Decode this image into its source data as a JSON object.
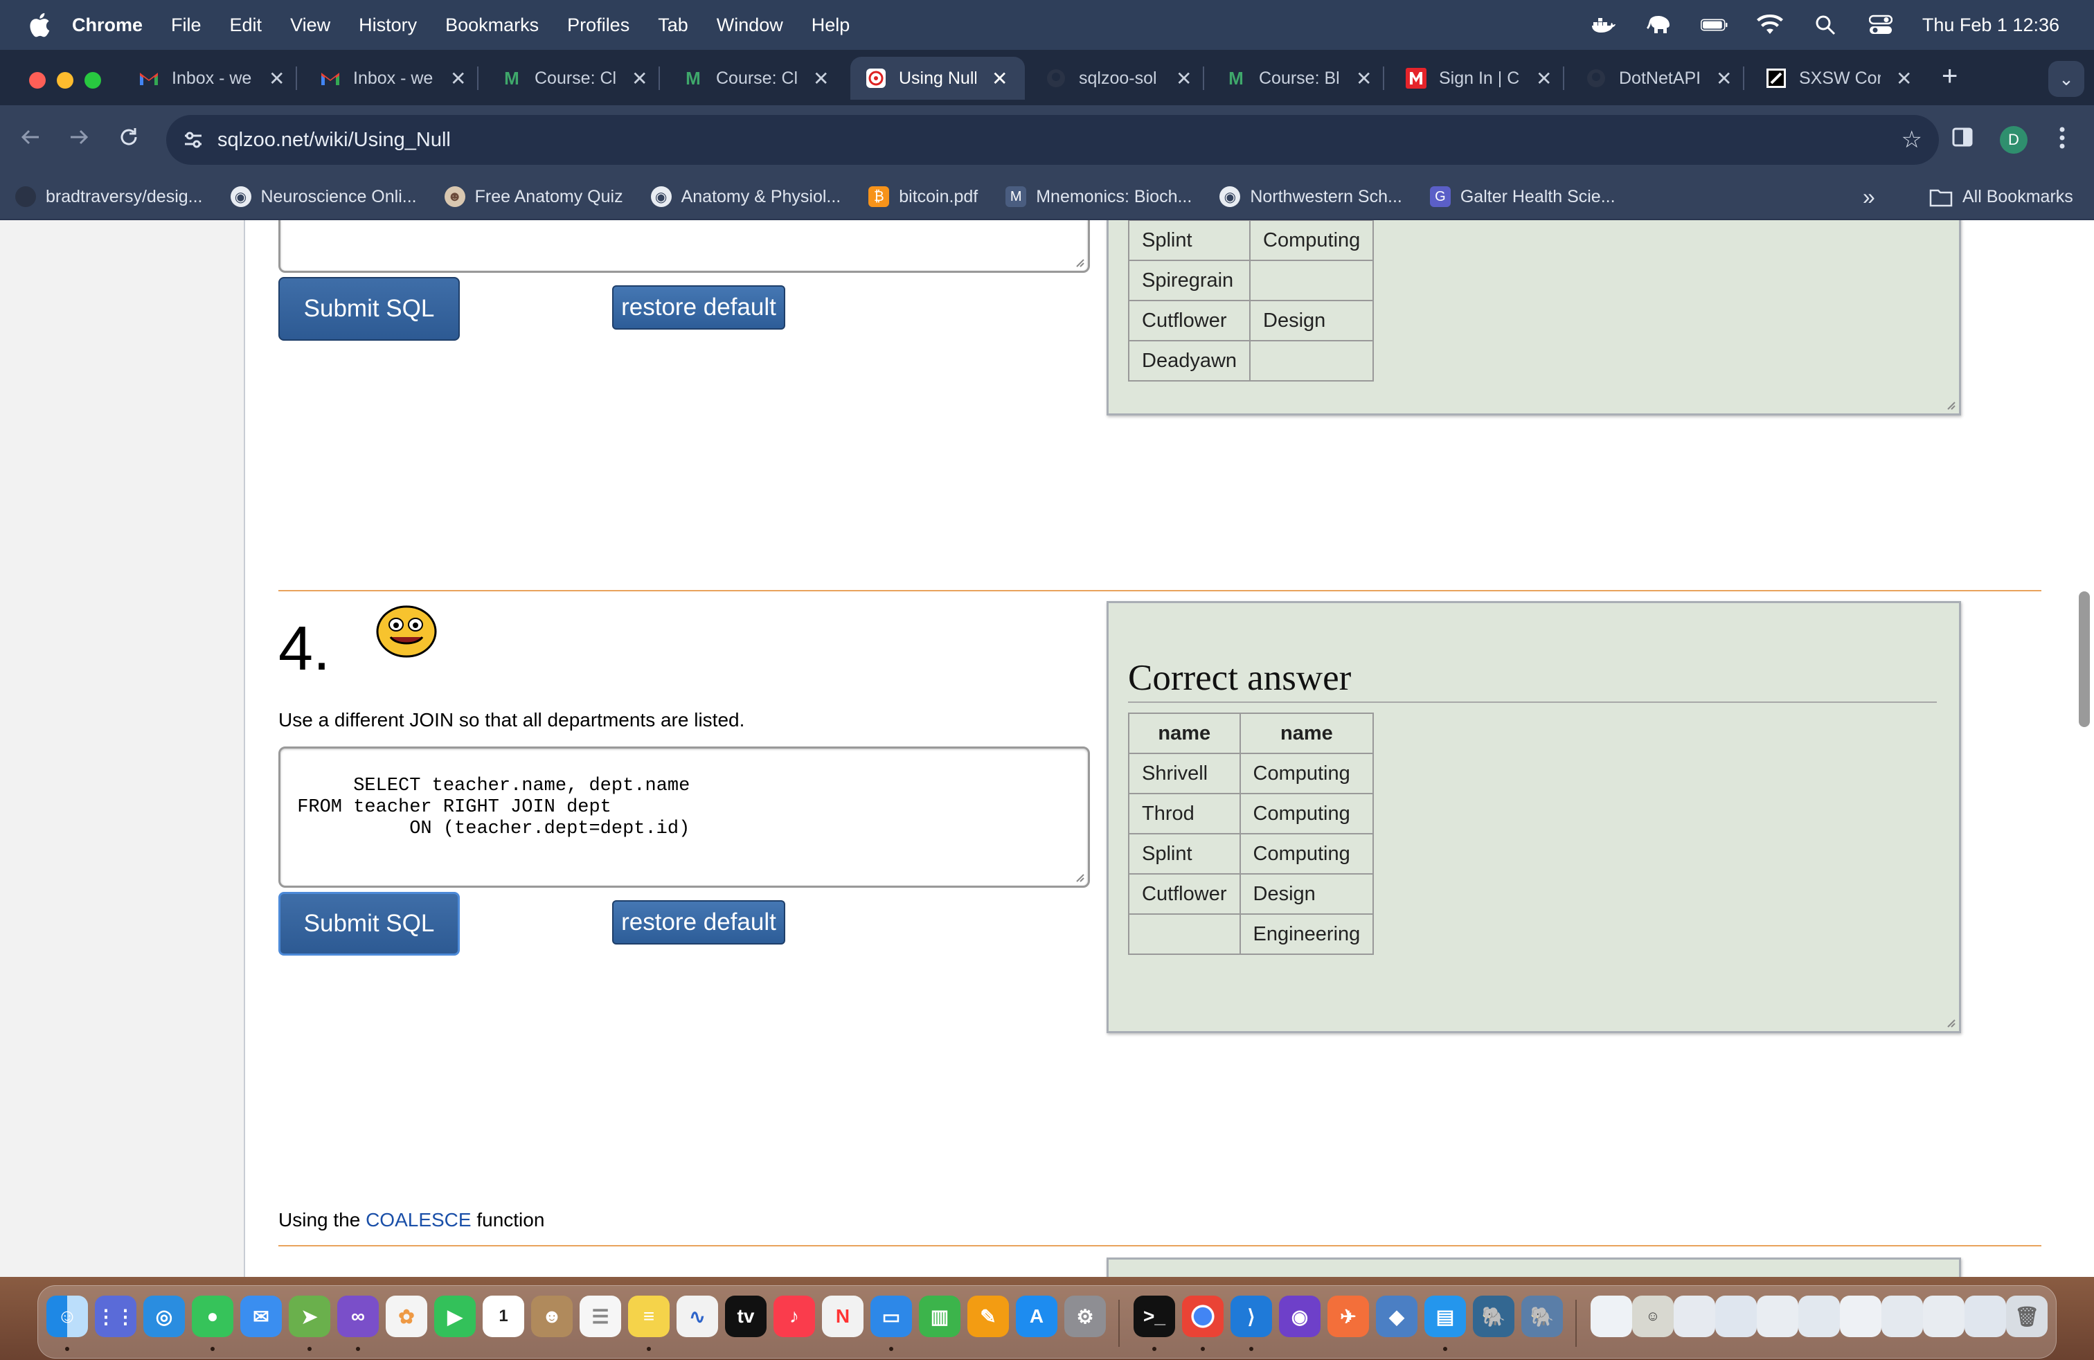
{
  "menubar": {
    "app": "Chrome",
    "items": [
      "File",
      "Edit",
      "View",
      "History",
      "Bookmarks",
      "Profiles",
      "Tab",
      "Window",
      "Help"
    ],
    "clock": "Thu Feb 1  12:36"
  },
  "tabs": [
    {
      "title": "Inbox - we",
      "icon": "gmail-icon"
    },
    {
      "title": "Inbox - we",
      "icon": "gmail-icon"
    },
    {
      "title": "Course: Cl",
      "icon": "course-m-icon"
    },
    {
      "title": "Course: Cl",
      "icon": "course-m-icon"
    },
    {
      "title": "Using Null",
      "icon": "sqlzoo-icon",
      "active": true
    },
    {
      "title": "sqlzoo-sol",
      "icon": "github-icon"
    },
    {
      "title": "Course: Bl",
      "icon": "course-m-icon"
    },
    {
      "title": "Sign In | C",
      "icon": "m-red-icon"
    },
    {
      "title": "DotNetAPI",
      "icon": "github-icon"
    },
    {
      "title": "SXSW Cor",
      "icon": "sxsw-icon"
    }
  ],
  "toolbar": {
    "url": "sqlzoo.net/wiki/Using_Null",
    "avatar_letter": "D"
  },
  "bookmarks": [
    {
      "label": "bradtraversy/desig...",
      "icon": "github-icon"
    },
    {
      "label": "Neuroscience Onli...",
      "icon": "globe-icon"
    },
    {
      "label": "Free Anatomy Quiz",
      "icon": "skull-icon"
    },
    {
      "label": "Anatomy & Physiol...",
      "icon": "globe-icon"
    },
    {
      "label": "bitcoin.pdf",
      "icon": "bitcoin-icon"
    },
    {
      "label": "Mnemonics: Bioch...",
      "icon": "mnemonics-icon"
    },
    {
      "label": "Northwestern Sch...",
      "icon": "globe-icon"
    },
    {
      "label": "Galter Health Scie...",
      "icon": "g-icon"
    }
  ],
  "bookmarks_all": "All Bookmarks",
  "q3": {
    "submit_label": "Submit SQL",
    "restore_label": "restore default",
    "rows": [
      [
        "Splint",
        "Computing"
      ],
      [
        "Spiregrain",
        ""
      ],
      [
        "Cutflower",
        "Design"
      ],
      [
        "Deadyawn",
        ""
      ]
    ]
  },
  "q4": {
    "number": "4.",
    "question": "Use a different JOIN so that all departments are listed.",
    "sql": "SELECT teacher.name, dept.name\n FROM teacher RIGHT JOIN dept\n           ON (teacher.dept=dept.id)",
    "submit_label": "Submit SQL",
    "restore_label": "restore default",
    "answer_title": "Correct answer",
    "columns": [
      "name",
      "name"
    ],
    "rows": [
      [
        "Shrivell",
        "Computing"
      ],
      [
        "Throd",
        "Computing"
      ],
      [
        "Splint",
        "Computing"
      ],
      [
        "Cutflower",
        "Design"
      ],
      [
        "",
        "Engineering"
      ]
    ]
  },
  "coalesce": {
    "prefix": "Using the ",
    "link": "COALESCE",
    "suffix": " function"
  },
  "colors": {
    "accent_orange": "#e8a35c",
    "answer_bg": "#dee6da",
    "button_blue": "#2d5a93",
    "link_blue": "#1a4fa8"
  }
}
